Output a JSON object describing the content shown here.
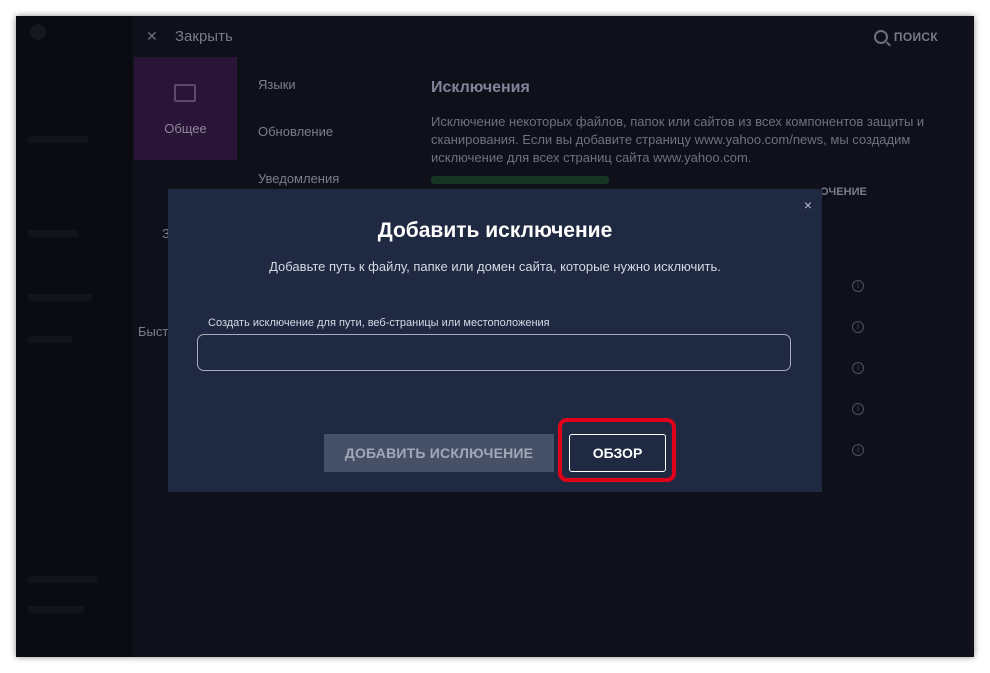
{
  "app": {
    "close_label": "Закрыть",
    "search_label": "ПОИСК",
    "tile_label": "Общее",
    "nav_items": [
      "Языки",
      "Обновление",
      "Уведомления"
    ],
    "partial_labels": [
      "З",
      "Быст"
    ],
    "section_heading": "Исключения",
    "section_description": "Исключение некоторых файлов, папок или сайтов из всех компонентов защиты и сканирования. Если вы добавите страницу www.yahoo.com/news, мы создадим исключение для всех страниц сайта www.yahoo.com.",
    "column_header": "ОЧЕНИЕ",
    "info_icon": "i"
  },
  "dialog": {
    "close_icon": "×",
    "title": "Добавить исключение",
    "description": "Добавьте путь к файлу, папке или домен сайта, которые нужно исключить.",
    "field_label": "Создать исключение для пути, веб-страницы или местоположения",
    "field_value": "",
    "add_button": "ДОБАВИТЬ ИСКЛЮЧЕНИЕ",
    "browse_button": "ОБЗОР"
  },
  "colors": {
    "dialog_bg": "#1f2942",
    "highlight": "#e1001c",
    "backdrop": "#0e0f19"
  }
}
